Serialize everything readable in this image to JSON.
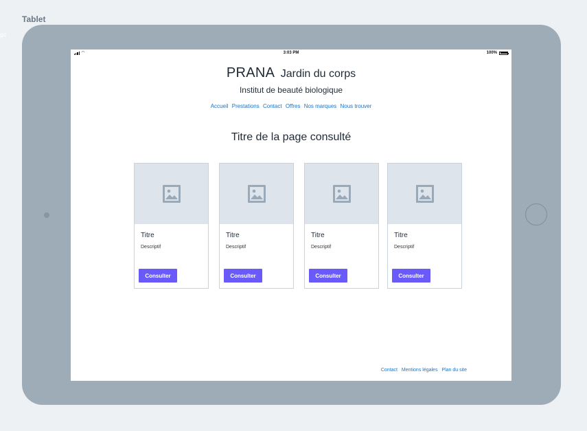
{
  "canvas": {
    "label": "Tablet",
    "stray_text": "go"
  },
  "status_bar": {
    "time": "3:03 PM",
    "battery_text": "100%"
  },
  "header": {
    "brand": "PRANA",
    "tagline": "Jardin du corps",
    "subtitle": "Institut de beauté biologique"
  },
  "nav": {
    "items": [
      {
        "label": "Accueil"
      },
      {
        "label": "Prestations"
      },
      {
        "label": "Contact"
      },
      {
        "label": "Offres"
      },
      {
        "label": "Nos marques"
      },
      {
        "label": "Nous trouver"
      }
    ]
  },
  "main": {
    "page_title": "Titre de la page consulté"
  },
  "cards": [
    {
      "title": "Titre",
      "description": "Descriptif",
      "button_label": "Consulter",
      "image_icon": "image-placeholder-icon"
    },
    {
      "title": "Titre",
      "description": "Descriptif",
      "button_label": "Consulter",
      "image_icon": "image-placeholder-icon"
    },
    {
      "title": "Titre",
      "description": "Descriptif",
      "button_label": "Consulter",
      "image_icon": "image-placeholder-icon"
    },
    {
      "title": "Titre",
      "description": "Descriptif",
      "button_label": "Consulter",
      "image_icon": "image-placeholder-icon"
    }
  ],
  "footer": {
    "links": [
      {
        "label": "Contact"
      },
      {
        "label": "Mentions légales"
      },
      {
        "label": "Plan du site"
      }
    ]
  },
  "colors": {
    "accent_button": "#6a5af9",
    "link": "#1a73c8",
    "tablet_frame": "#9eacb8",
    "placeholder_bg": "#dde4ec"
  }
}
